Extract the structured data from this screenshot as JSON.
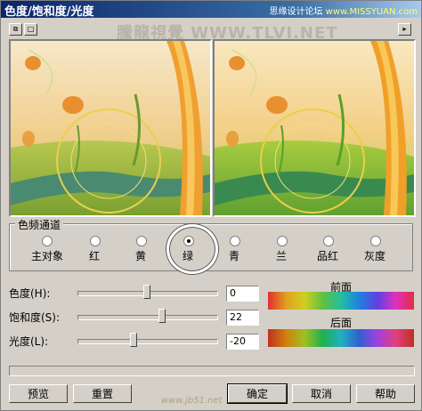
{
  "window": {
    "title": "色度/饱和度/光度",
    "credit_prefix": "思缘设计论坛",
    "credit_site": "www.MISSYUAN.com"
  },
  "watermark": "騰龍視覺 WWW.TLVI.NET",
  "toolbar": {
    "btn1": "⧉",
    "btn2": "□",
    "btn3": "▸"
  },
  "channel": {
    "legend": "色频通道",
    "options": [
      "主对象",
      "红",
      "黄",
      "绿",
      "青",
      "兰",
      "品红",
      "灰度"
    ],
    "selected": "绿"
  },
  "sliders": [
    {
      "label": "色度(H):",
      "value": "0"
    },
    {
      "label": "饱和度(S):",
      "value": "22"
    },
    {
      "label": "光度(L):",
      "value": "-20"
    }
  ],
  "hue_bars": {
    "before_label": "前面",
    "after_label": "后面"
  },
  "buttons": {
    "preview": "预览",
    "reset": "重置",
    "ok": "确定",
    "cancel": "取消",
    "help": "帮助"
  },
  "footer_site": "www.jb51.net"
}
